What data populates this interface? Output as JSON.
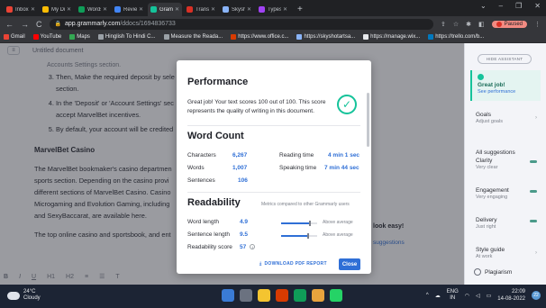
{
  "browser": {
    "tabs": [
      {
        "label": "Inbox (363)",
        "color": "#ea4335",
        "active": false
      },
      {
        "label": "My Drive -",
        "color": "#fbbc04",
        "active": false
      },
      {
        "label": "WordsWin",
        "color": "#0f9d58",
        "active": false
      },
      {
        "label": "Review on",
        "color": "#4285f4",
        "active": false
      },
      {
        "label": "Grammarly",
        "color": "#15c39a",
        "active": true
      },
      {
        "label": "Transition V",
        "color": "#d93025",
        "active": false
      },
      {
        "label": "Skyshot M",
        "color": "#8ab4f8",
        "active": false
      },
      {
        "label": "Types of ca",
        "color": "#a142f4",
        "active": false
      }
    ],
    "new_tab": "+",
    "window_controls": [
      "⌄",
      "–",
      "❐",
      "✕"
    ],
    "url": "app.grammarly.com",
    "url_path": "/ddocs/1694836733",
    "profile_status": "Paused",
    "bookmarks": [
      {
        "label": "Gmail",
        "color": "#ea4335"
      },
      {
        "label": "YouTube",
        "color": "#ff0000"
      },
      {
        "label": "Maps",
        "color": "#34a853"
      },
      {
        "label": "Hinglish To Hindi C...",
        "color": "#9aa0a6"
      },
      {
        "label": "Measure the Reada...",
        "color": "#9aa0a6"
      },
      {
        "label": "https://www.office.c...",
        "color": "#d83b01"
      },
      {
        "label": "https://skyshotartsa...",
        "color": "#8ab4f8"
      },
      {
        "label": "https://manage.wix...",
        "color": "#e8eaed"
      },
      {
        "label": "https://trello.com/b...",
        "color": "#0079bf"
      }
    ]
  },
  "document": {
    "title": "Untitled document",
    "cut_line": "Accounts Settings section.",
    "steps": [
      "Then, Make the required deposit by sele",
      "In the 'Deposit' or 'Account Settings' sec",
      "By default, your account will be credited"
    ],
    "step_continuations": [
      "section.",
      "accept MarvelBet incentives.",
      ""
    ],
    "heading": "MarvelBet Casino",
    "paragraph_lines": [
      "The MarvelBet bookmaker's casino departmen",
      "sports section. Depending on the casino provi",
      "different sections of MarvelBet Casino. Casino",
      "Microgaming and Evolution Gaming, including",
      "and SexyBaccarat, are available here."
    ],
    "last_line": "The top online casino and sportsbook, and ent",
    "side_easy": "look easy!",
    "side_suggestions": "suggestions",
    "format_bar": [
      "B",
      "I",
      "U",
      "H1",
      "H2",
      "≡",
      "☰",
      "T"
    ]
  },
  "assistant": {
    "button_label": "HIDE ASSISTANT",
    "great_job_title": "Great job!",
    "great_job_sub": "See performance",
    "goals_title": "Goals",
    "goals_sub": "Adjust goals",
    "all_suggestions": "All suggestions",
    "clarity_title": "Clarity",
    "clarity_sub": "Very clear",
    "engagement_title": "Engagement",
    "engagement_sub": "Very engaging",
    "delivery_title": "Delivery",
    "delivery_sub": "Just right",
    "style_title": "Style guide",
    "style_sub": "At work",
    "plagiarism": "Plagiarism"
  },
  "performance": {
    "title": "Performance",
    "summary": "Great job! Your text scores 100 out of 100. This score represents the quality of writing in this document.",
    "score": 100,
    "word_count_title": "Word Count",
    "characters_label": "Characters",
    "characters_value": "6,267",
    "words_label": "Words",
    "words_value": "1,007",
    "sentences_label": "Sentences",
    "sentences_value": "106",
    "reading_time_label": "Reading time",
    "reading_time_value": "4 min 1 sec",
    "speaking_time_label": "Speaking time",
    "speaking_time_value": "7 min 44 sec",
    "readability_title": "Readability",
    "metrics_note": "Metrics compared to other Grammarly users",
    "word_length_label": "Word length",
    "word_length_value": "4.9",
    "word_length_tag": "Above average",
    "word_length_fraction": 0.8,
    "sentence_length_label": "Sentence length",
    "sentence_length_value": "9.5",
    "sentence_length_tag": "Above average",
    "sentence_length_fraction": 0.75,
    "readability_score_label": "Readability score",
    "readability_score_value": "57",
    "download_label": "DOWNLOAD PDF REPORT",
    "close_label": "Close"
  },
  "taskbar": {
    "temperature": "24°C",
    "weather": "Cloudy",
    "lang_1": "ENG",
    "lang_2": "IN",
    "time": "22:09",
    "date": "14-08-2022",
    "notifications": "22",
    "app_colors": [
      "#3a7bd5",
      "#6b7280",
      "#f4c430",
      "#d83b01",
      "#0f9d58",
      "#e8a33d",
      "#25d366"
    ]
  },
  "colors": {
    "accent": "#2f6fd6",
    "grammarly_green": "#15c39a"
  }
}
